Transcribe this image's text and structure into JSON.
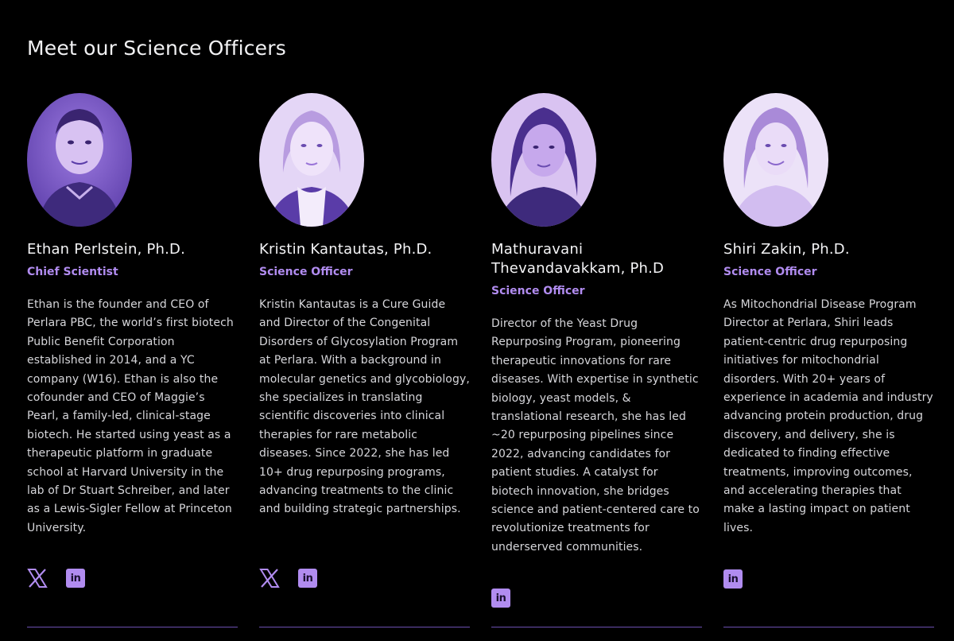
{
  "section": {
    "title": "Meet our Science Officers"
  },
  "officers": [
    {
      "name": "Ethan Perlstein, Ph.D.",
      "role": "Chief Scientist",
      "bio": "Ethan is the founder and CEO of Perlara PBC, the world’s first biotech Public Benefit Corporation established in 2014, and a YC company (W16). Ethan is also the cofounder and CEO of Maggie’s Pearl, a family-led, clinical-stage biotech. He started using yeast as a therapeutic platform in graduate school at Harvard University in the lab of Dr Stuart Schreiber, and later as a Lewis-Sigler Fellow at Princeton University.",
      "socials": [
        "x-icon",
        "linkedin-icon"
      ],
      "linkedin_label": "in"
    },
    {
      "name": "Kristin Kantautas, Ph.D.",
      "role": "Science Officer",
      "bio": "Kristin Kantautas is a Cure Guide and Director of the Congenital Disorders of Glycosylation Program at Perlara. With a background in molecular genetics and glycobiology, she specializes in translating scientific discoveries into clinical therapies for rare metabolic diseases. Since 2022, she has led 10+ drug repurposing programs, advancing treatments to the clinic and building strategic partnerships.",
      "socials": [
        "x-icon",
        "linkedin-icon"
      ],
      "linkedin_label": "in"
    },
    {
      "name": "Mathuravani Thevandavakkam, Ph.D",
      "role": "Science Officer",
      "bio": "Director of the Yeast Drug Repurposing Program, pioneering therapeutic innovations for rare diseases. With expertise in synthetic biology, yeast models, & translational research, she has led ~20 repurposing pipelines since 2022, advancing candidates for patient studies. A catalyst for biotech innovation, she bridges science and patient-centered care to revolutionize treatments for underserved communities.",
      "socials": [
        "linkedin-icon"
      ],
      "linkedin_label": "in"
    },
    {
      "name": "Shiri Zakin, Ph.D.",
      "role": "Science Officer",
      "bio": "As Mitochondrial Disease Program Director at Perlara, Shiri leads patient-centric drug repurposing initiatives for mitochondrial disorders. With 20+ years of experience in academia and industry advancing protein production, drug discovery, and delivery, she is dedicated to finding effective treatments, improving outcomes, and accelerating therapies that make a lasting impact on patient lives.",
      "socials": [
        "linkedin-icon"
      ],
      "linkedin_label": "in"
    }
  ],
  "colors": {
    "background": "#000000",
    "accent": "#b18cf0",
    "divider": "#6b4fb0",
    "text": "#d6d6da"
  }
}
